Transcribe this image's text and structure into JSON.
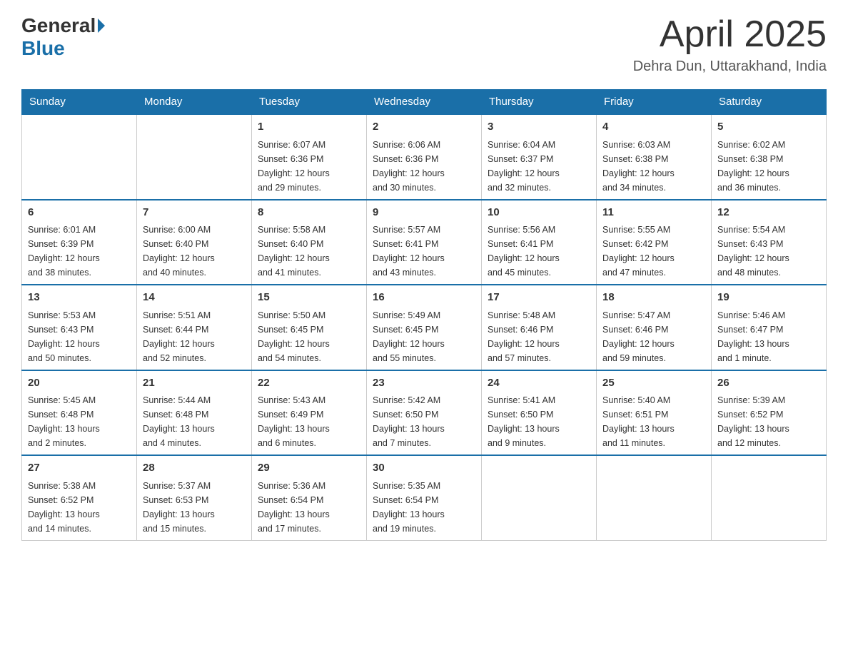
{
  "header": {
    "logo_general": "General",
    "logo_blue": "Blue",
    "month_title": "April 2025",
    "location": "Dehra Dun, Uttarakhand, India"
  },
  "days_of_week": [
    "Sunday",
    "Monday",
    "Tuesday",
    "Wednesday",
    "Thursday",
    "Friday",
    "Saturday"
  ],
  "weeks": [
    [
      {
        "day": "",
        "info": ""
      },
      {
        "day": "",
        "info": ""
      },
      {
        "day": "1",
        "info": "Sunrise: 6:07 AM\nSunset: 6:36 PM\nDaylight: 12 hours\nand 29 minutes."
      },
      {
        "day": "2",
        "info": "Sunrise: 6:06 AM\nSunset: 6:36 PM\nDaylight: 12 hours\nand 30 minutes."
      },
      {
        "day": "3",
        "info": "Sunrise: 6:04 AM\nSunset: 6:37 PM\nDaylight: 12 hours\nand 32 minutes."
      },
      {
        "day": "4",
        "info": "Sunrise: 6:03 AM\nSunset: 6:38 PM\nDaylight: 12 hours\nand 34 minutes."
      },
      {
        "day": "5",
        "info": "Sunrise: 6:02 AM\nSunset: 6:38 PM\nDaylight: 12 hours\nand 36 minutes."
      }
    ],
    [
      {
        "day": "6",
        "info": "Sunrise: 6:01 AM\nSunset: 6:39 PM\nDaylight: 12 hours\nand 38 minutes."
      },
      {
        "day": "7",
        "info": "Sunrise: 6:00 AM\nSunset: 6:40 PM\nDaylight: 12 hours\nand 40 minutes."
      },
      {
        "day": "8",
        "info": "Sunrise: 5:58 AM\nSunset: 6:40 PM\nDaylight: 12 hours\nand 41 minutes."
      },
      {
        "day": "9",
        "info": "Sunrise: 5:57 AM\nSunset: 6:41 PM\nDaylight: 12 hours\nand 43 minutes."
      },
      {
        "day": "10",
        "info": "Sunrise: 5:56 AM\nSunset: 6:41 PM\nDaylight: 12 hours\nand 45 minutes."
      },
      {
        "day": "11",
        "info": "Sunrise: 5:55 AM\nSunset: 6:42 PM\nDaylight: 12 hours\nand 47 minutes."
      },
      {
        "day": "12",
        "info": "Sunrise: 5:54 AM\nSunset: 6:43 PM\nDaylight: 12 hours\nand 48 minutes."
      }
    ],
    [
      {
        "day": "13",
        "info": "Sunrise: 5:53 AM\nSunset: 6:43 PM\nDaylight: 12 hours\nand 50 minutes."
      },
      {
        "day": "14",
        "info": "Sunrise: 5:51 AM\nSunset: 6:44 PM\nDaylight: 12 hours\nand 52 minutes."
      },
      {
        "day": "15",
        "info": "Sunrise: 5:50 AM\nSunset: 6:45 PM\nDaylight: 12 hours\nand 54 minutes."
      },
      {
        "day": "16",
        "info": "Sunrise: 5:49 AM\nSunset: 6:45 PM\nDaylight: 12 hours\nand 55 minutes."
      },
      {
        "day": "17",
        "info": "Sunrise: 5:48 AM\nSunset: 6:46 PM\nDaylight: 12 hours\nand 57 minutes."
      },
      {
        "day": "18",
        "info": "Sunrise: 5:47 AM\nSunset: 6:46 PM\nDaylight: 12 hours\nand 59 minutes."
      },
      {
        "day": "19",
        "info": "Sunrise: 5:46 AM\nSunset: 6:47 PM\nDaylight: 13 hours\nand 1 minute."
      }
    ],
    [
      {
        "day": "20",
        "info": "Sunrise: 5:45 AM\nSunset: 6:48 PM\nDaylight: 13 hours\nand 2 minutes."
      },
      {
        "day": "21",
        "info": "Sunrise: 5:44 AM\nSunset: 6:48 PM\nDaylight: 13 hours\nand 4 minutes."
      },
      {
        "day": "22",
        "info": "Sunrise: 5:43 AM\nSunset: 6:49 PM\nDaylight: 13 hours\nand 6 minutes."
      },
      {
        "day": "23",
        "info": "Sunrise: 5:42 AM\nSunset: 6:50 PM\nDaylight: 13 hours\nand 7 minutes."
      },
      {
        "day": "24",
        "info": "Sunrise: 5:41 AM\nSunset: 6:50 PM\nDaylight: 13 hours\nand 9 minutes."
      },
      {
        "day": "25",
        "info": "Sunrise: 5:40 AM\nSunset: 6:51 PM\nDaylight: 13 hours\nand 11 minutes."
      },
      {
        "day": "26",
        "info": "Sunrise: 5:39 AM\nSunset: 6:52 PM\nDaylight: 13 hours\nand 12 minutes."
      }
    ],
    [
      {
        "day": "27",
        "info": "Sunrise: 5:38 AM\nSunset: 6:52 PM\nDaylight: 13 hours\nand 14 minutes."
      },
      {
        "day": "28",
        "info": "Sunrise: 5:37 AM\nSunset: 6:53 PM\nDaylight: 13 hours\nand 15 minutes."
      },
      {
        "day": "29",
        "info": "Sunrise: 5:36 AM\nSunset: 6:54 PM\nDaylight: 13 hours\nand 17 minutes."
      },
      {
        "day": "30",
        "info": "Sunrise: 5:35 AM\nSunset: 6:54 PM\nDaylight: 13 hours\nand 19 minutes."
      },
      {
        "day": "",
        "info": ""
      },
      {
        "day": "",
        "info": ""
      },
      {
        "day": "",
        "info": ""
      }
    ]
  ]
}
